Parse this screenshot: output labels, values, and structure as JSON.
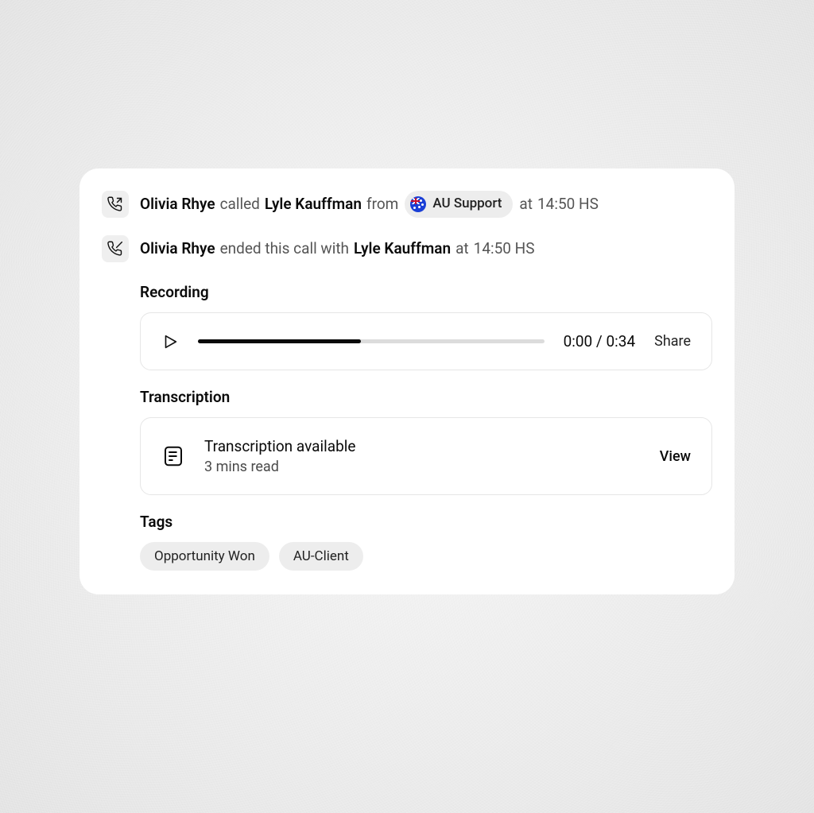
{
  "events": {
    "call_start": {
      "caller": "Olivia Rhye",
      "verb": "called",
      "callee": "Lyle Kauffman",
      "from_word": "from",
      "source_label": "AU Support",
      "at_word": "at",
      "time": "14:50 HS"
    },
    "call_end": {
      "actor": "Olivia Rhye",
      "verb": "ended this call with",
      "callee": "Lyle Kauffman",
      "at_word": "at",
      "time": "14:50 HS"
    }
  },
  "recording": {
    "title": "Recording",
    "current_time": "0:00",
    "separator": "/",
    "duration": "0:34",
    "share_label": "Share",
    "progress_percent": 47
  },
  "transcription": {
    "title": "Transcription",
    "status": "Transcription available",
    "read_time": "3 mins read",
    "view_label": "View"
  },
  "tags": {
    "title": "Tags",
    "items": [
      "Opportunity Won",
      "AU-Client"
    ]
  }
}
